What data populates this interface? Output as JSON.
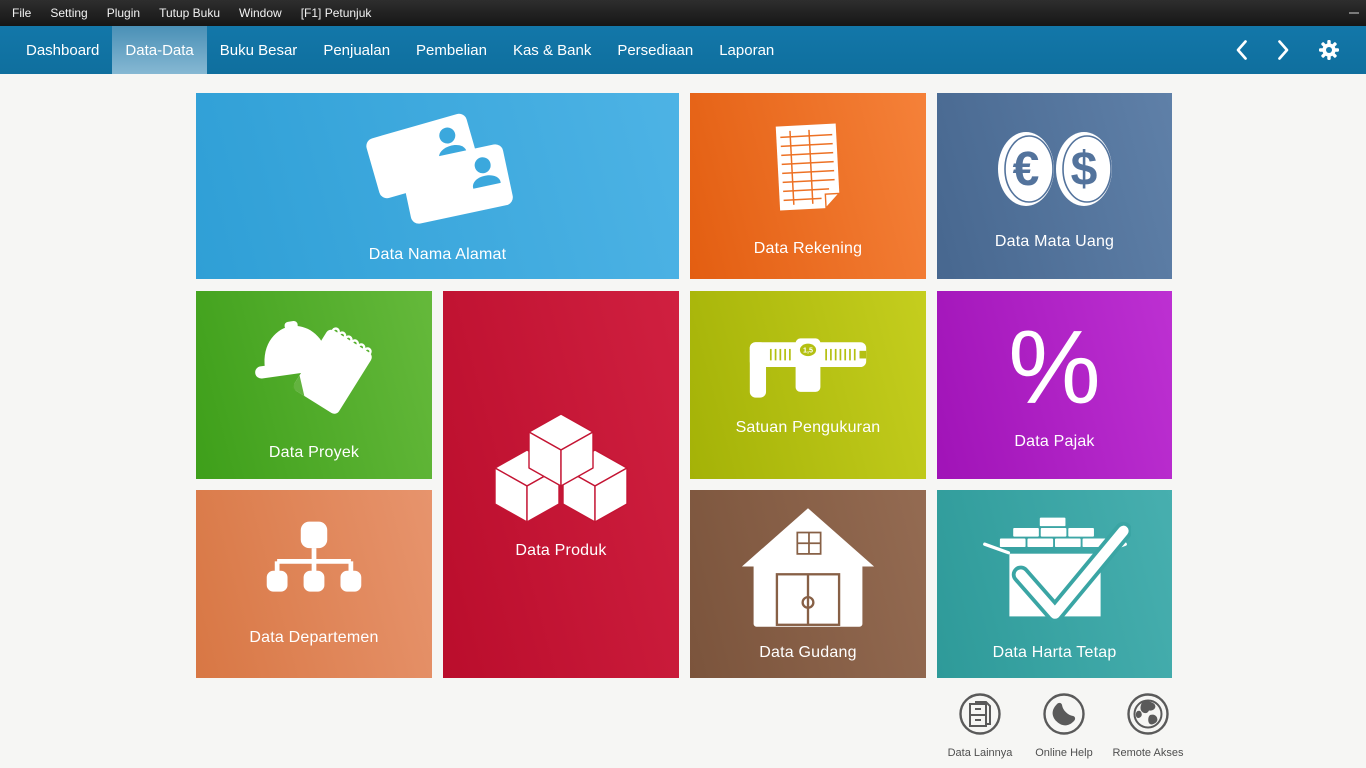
{
  "colors": {
    "menubar_bg": "#232323",
    "navbar_bg": "#1377a9",
    "navbar_bg_dark": "#0f6f9e",
    "selected_tab_top": "#4a90b6",
    "selected_tab_bottom": "#86b8d3",
    "content_bg": "#f6f6f4",
    "footer_icon": "#5a5a5a",
    "footer_label": "#4f4f4f"
  },
  "menubar": {
    "items": [
      {
        "label": "File"
      },
      {
        "label": "Setting"
      },
      {
        "label": "Plugin"
      },
      {
        "label": "Tutup Buku"
      },
      {
        "label": "Window"
      },
      {
        "label": "[F1] Petunjuk"
      }
    ]
  },
  "navbar": {
    "tabs": [
      {
        "label": "Dashboard",
        "selected": false
      },
      {
        "label": "Data-Data",
        "selected": true
      },
      {
        "label": "Buku Besar",
        "selected": false
      },
      {
        "label": "Penjualan",
        "selected": false
      },
      {
        "label": "Pembelian",
        "selected": false
      },
      {
        "label": "Kas & Bank",
        "selected": false
      },
      {
        "label": "Persediaan",
        "selected": false
      },
      {
        "label": "Laporan",
        "selected": false
      }
    ],
    "icons": [
      "nav-back",
      "nav-forward",
      "settings-gear"
    ]
  },
  "tiles": [
    {
      "label": "Data Nama Alamat",
      "icon": "id-cards-icon",
      "color_dark": "#2f9fd6",
      "color_light": "#4db3e5",
      "accent": "#3ba8dd"
    },
    {
      "label": "Data Rekening",
      "icon": "ledger-icon",
      "color_dark": "#e35e11",
      "color_light": "#f58139",
      "accent": "#ed7124"
    },
    {
      "label": "Data Mata Uang",
      "icon": "currency-coins-icon",
      "color_dark": "#47678f",
      "color_light": "#5f80a8",
      "accent": "#53739c",
      "coin_symbols": [
        "€",
        "$"
      ]
    },
    {
      "label": "Data Proyek",
      "icon": "hardhat-notepad-icon",
      "color_dark": "#3e9f1a",
      "color_light": "#65b93b",
      "accent": "#52ab2a"
    },
    {
      "label": "Data Produk",
      "icon": "cubes-icon",
      "color_dark": "#ba0d2c",
      "color_light": "#d02040",
      "accent": "#c41534"
    },
    {
      "label": "Satuan Pengukuran",
      "icon": "caliper-icon",
      "color_dark": "#a4b207",
      "color_light": "#c5ce1e",
      "accent": "#b4c012",
      "caliper_reading": "1,5"
    },
    {
      "label": "Data Pajak",
      "icon": "percent-icon",
      "color_dark": "#a013b7",
      "color_light": "#bd30d2",
      "accent": "#b021c6",
      "glyph": "%"
    },
    {
      "label": "Data Departemen",
      "icon": "org-chart-icon",
      "color_dark": "#d87744",
      "color_light": "#e7946d",
      "accent": "#df8657"
    },
    {
      "label": "Data Gudang",
      "icon": "warehouse-icon",
      "color_dark": "#7b543c",
      "color_light": "#946b52",
      "accent": "#876046"
    },
    {
      "label": "Data Harta Tetap",
      "icon": "asset-check-icon",
      "color_dark": "#2e9a99",
      "color_light": "#47afaf",
      "accent": "#3aa5a4"
    }
  ],
  "footer_shortcuts": [
    {
      "label": "Data Lainnya",
      "icon": "cabinet-icon"
    },
    {
      "label": "Online Help",
      "icon": "phone-icon"
    },
    {
      "label": "Remote Akses",
      "icon": "globe-icon"
    }
  ]
}
